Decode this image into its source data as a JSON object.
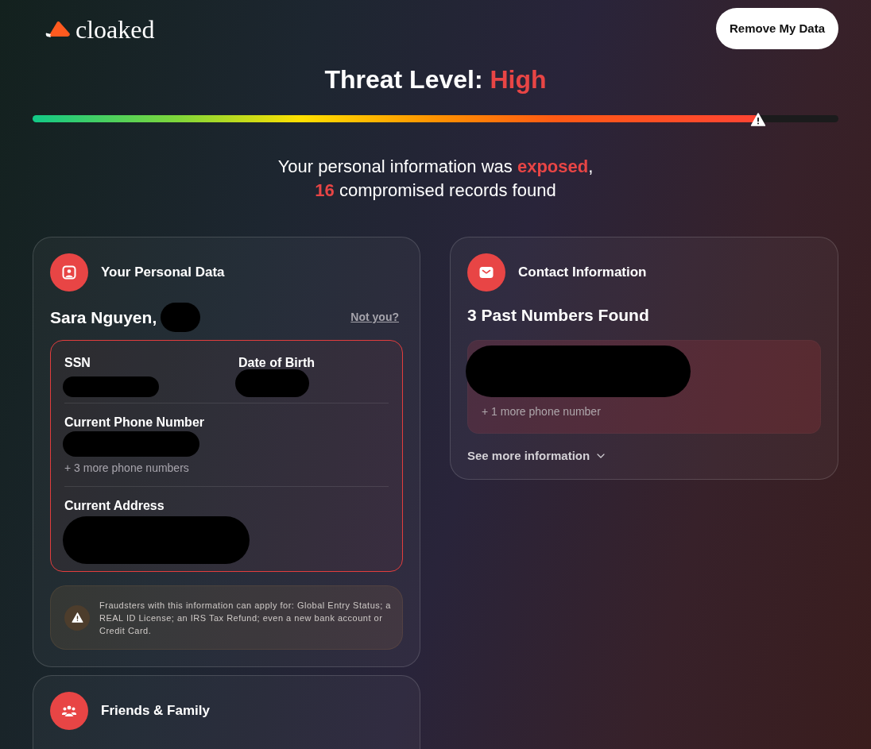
{
  "brand": {
    "name": "cloaked"
  },
  "header": {
    "action": "Remove My Data"
  },
  "threat": {
    "label": "Threat Level:",
    "rating": "High",
    "level": 0.9
  },
  "summary": {
    "lines": [
      [
        {
          "text": "Your personal information was ",
          "highlight": false
        },
        {
          "text": "exposed",
          "highlight": true
        },
        {
          "text": ",",
          "highlight": false
        }
      ],
      [
        {
          "text": "16",
          "highlight": true
        },
        {
          "text": " compromised records found",
          "highlight": false
        }
      ]
    ]
  },
  "personal_data": {
    "title": "Your Personal Data",
    "name": "Sara Nguyen,",
    "not_you": "Not you?",
    "rows": [
      {
        "fields": [
          {
            "label": "SSN"
          },
          {
            "label": "Date of Birth"
          }
        ]
      },
      {
        "fields": [
          {
            "label": "Current Phone Number",
            "more": "+ 3 more phone numbers"
          }
        ]
      },
      {
        "fields": [
          {
            "label": "Current Address"
          }
        ]
      }
    ],
    "warning": "Fraudsters with this information can apply for: Global Entry Status; a REAL ID License; an IRS Tax Refund; even a new bank account or Credit Card."
  },
  "contact_information": {
    "title": "Contact Information",
    "heading": "3 Past Numbers Found",
    "more": "+ 1 more phone number",
    "see_more": "See more information"
  },
  "friends_family": {
    "title": "Friends & Family"
  }
}
